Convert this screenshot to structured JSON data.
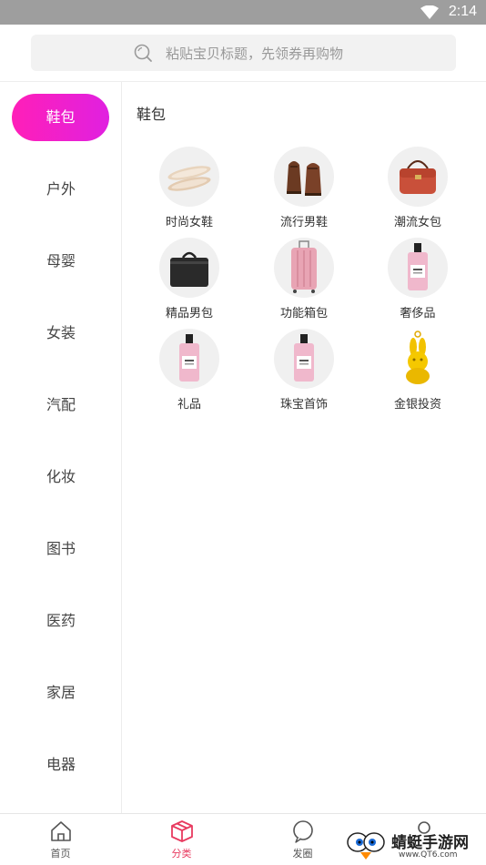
{
  "status": {
    "time": "2:14"
  },
  "search": {
    "placeholder": "粘贴宝贝标题，先领券再购物"
  },
  "sidebar": {
    "items": [
      {
        "label": "鞋包",
        "active": true
      },
      {
        "label": "户外"
      },
      {
        "label": "母婴"
      },
      {
        "label": "女装"
      },
      {
        "label": "汽配"
      },
      {
        "label": "化妆"
      },
      {
        "label": "图书"
      },
      {
        "label": "医药"
      },
      {
        "label": "家居"
      },
      {
        "label": "电器"
      }
    ]
  },
  "content": {
    "title": "鞋包",
    "cells": [
      {
        "label": "时尚女鞋",
        "icon": "flat-shoes-icon"
      },
      {
        "label": "流行男鞋",
        "icon": "mens-shoes-icon"
      },
      {
        "label": "潮流女包",
        "icon": "handbag-icon"
      },
      {
        "label": "精品男包",
        "icon": "briefcase-icon"
      },
      {
        "label": "功能箱包",
        "icon": "suitcase-icon"
      },
      {
        "label": "奢侈品",
        "icon": "perfume-icon"
      },
      {
        "label": "礼品",
        "icon": "perfume-icon"
      },
      {
        "label": "珠宝首饰",
        "icon": "perfume-icon"
      },
      {
        "label": "金银投资",
        "icon": "gold-pendant-icon"
      }
    ]
  },
  "tabbar": {
    "items": [
      {
        "label": "首页",
        "icon": "home-icon"
      },
      {
        "label": "分类",
        "icon": "category-box-icon",
        "active": true
      },
      {
        "label": "发圈",
        "icon": "chat-bubble-icon"
      },
      {
        "label": "",
        "icon": "profile-icon"
      }
    ]
  },
  "watermark": {
    "name": "蜻蜓手游网",
    "url": "www.QT6.com"
  },
  "colors": {
    "accent": "#e83a5f",
    "sidebar_active_start": "#ff1fb8",
    "sidebar_active_end": "#e020e0",
    "status_bar": "#9e9e9e"
  }
}
